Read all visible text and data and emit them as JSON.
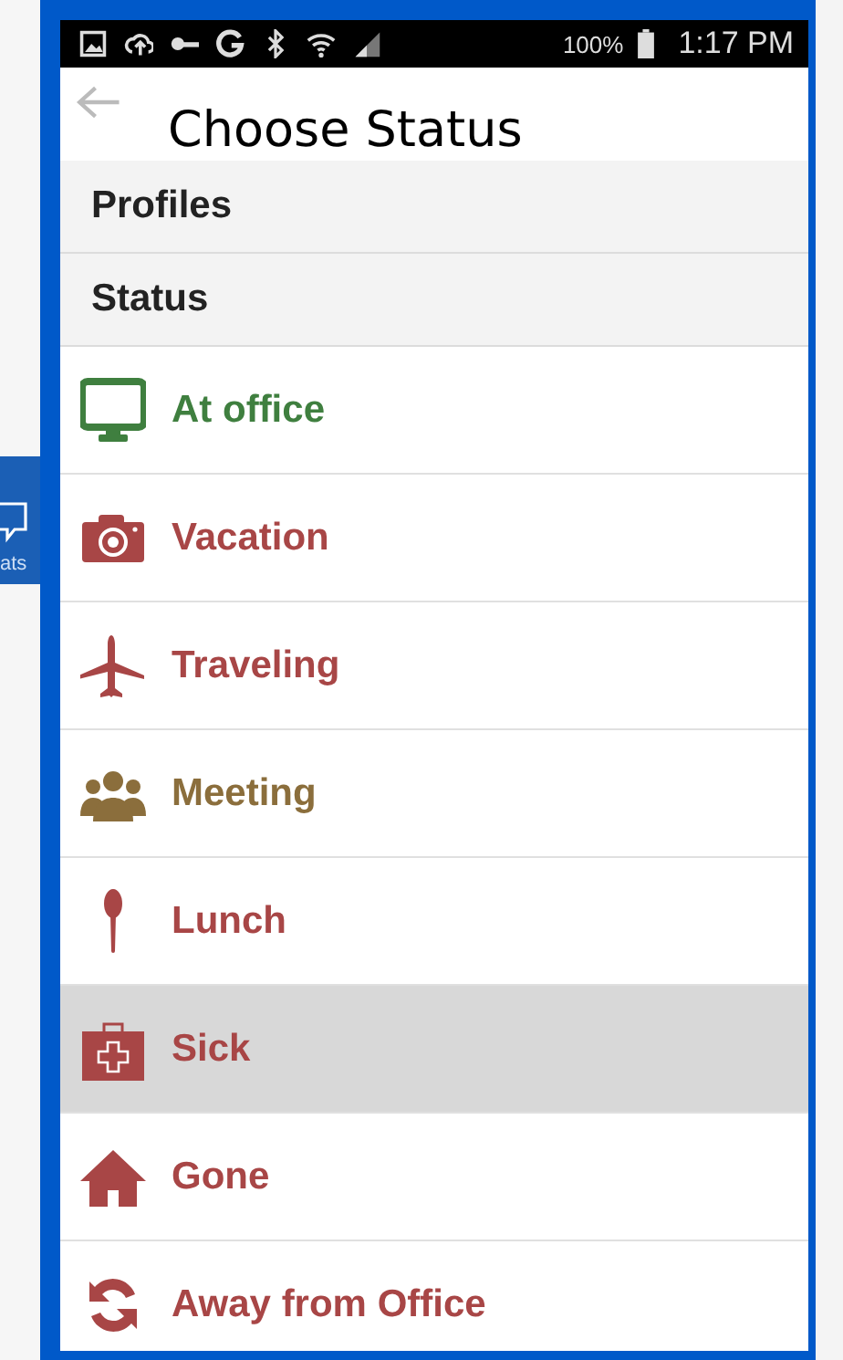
{
  "side_tab": {
    "label": "ats"
  },
  "status_bar": {
    "battery": "100%",
    "time": "1:17 PM"
  },
  "app_bar": {
    "title": "Choose Status"
  },
  "sections": [
    {
      "label": "Profiles"
    },
    {
      "label": "Status"
    }
  ],
  "statuses": [
    {
      "label": "At office",
      "kind": "monitor",
      "color": "#3f7f3f",
      "selected": false
    },
    {
      "label": "Vacation",
      "kind": "camera",
      "color": "#a84646",
      "selected": false
    },
    {
      "label": "Traveling",
      "kind": "plane",
      "color": "#a84646",
      "selected": false
    },
    {
      "label": "Meeting",
      "kind": "people",
      "color": "#8b6e3c",
      "selected": false
    },
    {
      "label": "Lunch",
      "kind": "spoon",
      "color": "#a84646",
      "selected": false
    },
    {
      "label": "Sick",
      "kind": "medkit",
      "color": "#a84646",
      "selected": true
    },
    {
      "label": "Gone",
      "kind": "house",
      "color": "#a84646",
      "selected": false
    },
    {
      "label": "Away from Office",
      "kind": "sync",
      "color": "#a84646",
      "selected": false
    }
  ]
}
